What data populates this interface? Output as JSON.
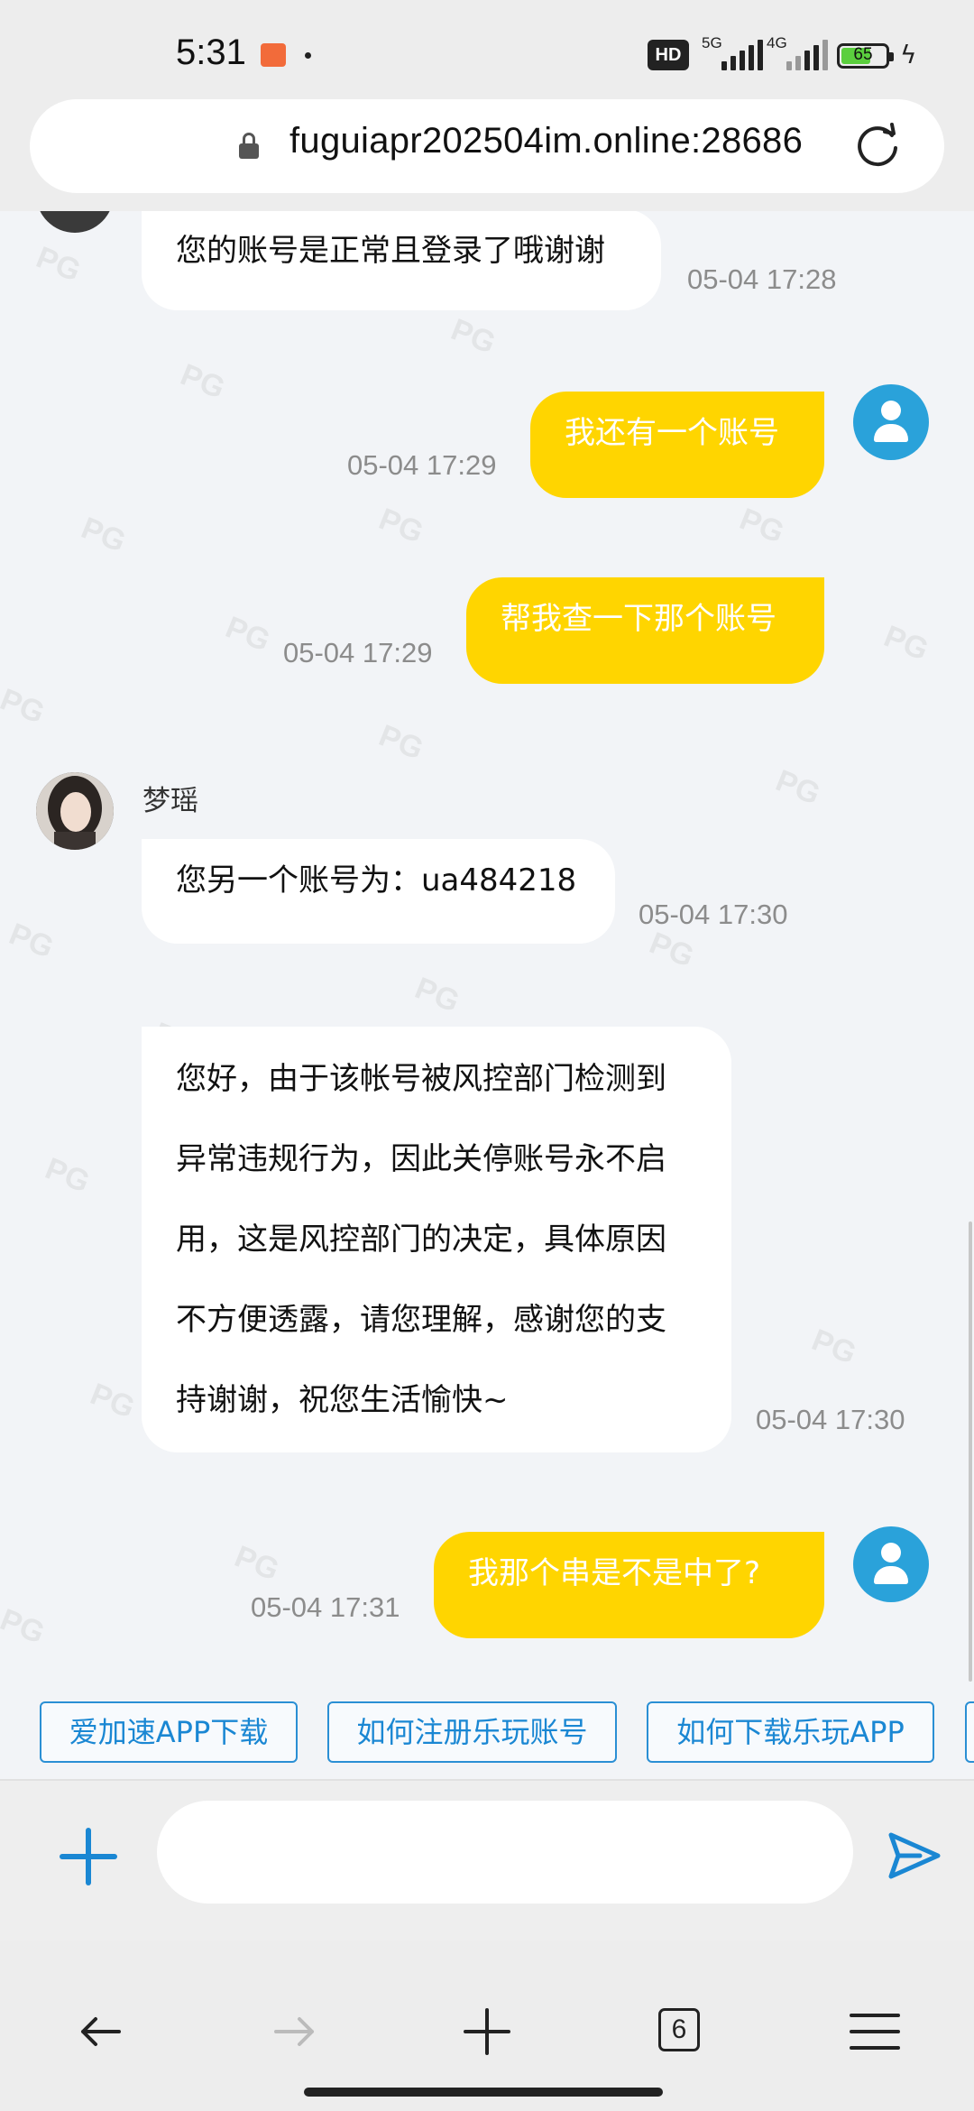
{
  "status_bar": {
    "time": "5:31",
    "hd_label": "HD",
    "network_1": "5G",
    "network_2": "4G",
    "battery": "65"
  },
  "browser": {
    "url": "fuguiapr202504im.online:28686",
    "tab_count": "6"
  },
  "chat": {
    "agent_name": "梦瑶",
    "messages": [
      {
        "from": "agent",
        "text": "您的账号是正常且登录了哦谢谢",
        "time": "05-04 17:28"
      },
      {
        "from": "user",
        "text": "我还有一个账号",
        "time": "05-04 17:29"
      },
      {
        "from": "user",
        "text": "帮我查一下那个账号",
        "time": "05-04 17:29"
      },
      {
        "from": "agent",
        "text": "您另一个账号为：ua484218",
        "time": "05-04 17:30"
      },
      {
        "from": "agent",
        "lines": [
          "您好，由于该帐号被风控部门检测到",
          "异常违规行为，因此关停账号永不启",
          "用，这是风控部门的决定，具体原因",
          "不方便透露，请您理解，感谢您的支",
          "持谢谢，祝您生活愉快~"
        ],
        "time": "05-04 17:30"
      },
      {
        "from": "user",
        "text": "我那个串是不是中了?",
        "time": "05-04 17:31"
      }
    ]
  },
  "quick_replies": [
    "爱加速APP下载",
    "如何注册乐玩账号",
    "如何下载乐玩APP"
  ],
  "input": {
    "placeholder": "",
    "value": ""
  },
  "watermark": "PG",
  "colors": {
    "user_bubble": "#ffd500",
    "agent_bubble": "#ffffff",
    "accent": "#1a87d3",
    "avatar": "#2aa2da"
  },
  "icons": [
    "lock-icon",
    "reload-icon",
    "add-icon",
    "send-icon",
    "back-icon",
    "forward-icon",
    "new-tab-icon",
    "tabs-icon",
    "menu-icon"
  ]
}
